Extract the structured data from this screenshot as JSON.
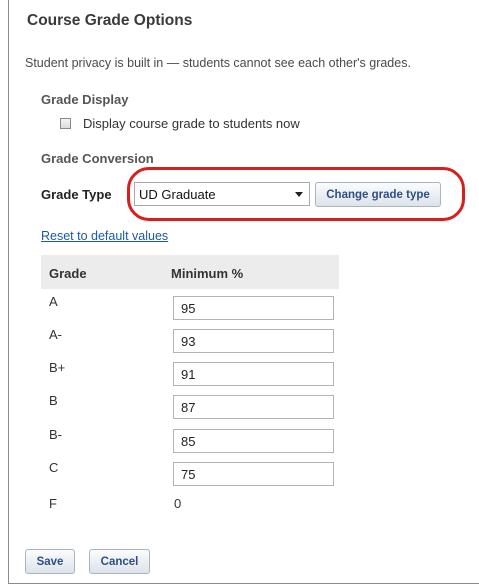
{
  "header": {
    "title": "Course Grade Options",
    "privacy_note": "Student privacy is built in — students cannot see each other's grades."
  },
  "grade_display": {
    "heading": "Grade Display",
    "checkbox_label": "Display course grade to students now",
    "checked": false
  },
  "grade_conversion": {
    "heading": "Grade Conversion",
    "grade_type_label": "Grade Type",
    "selected_type": "UD Graduate",
    "change_button": "Change grade type",
    "reset_link": "Reset to default values"
  },
  "grade_table": {
    "col_grade": "Grade",
    "col_minimum": "Minimum %",
    "rows": [
      {
        "grade": "A",
        "minimum": "95"
      },
      {
        "grade": "A-",
        "minimum": "93"
      },
      {
        "grade": "B+",
        "minimum": "91"
      },
      {
        "grade": "B",
        "minimum": "87"
      },
      {
        "grade": "B-",
        "minimum": "85"
      },
      {
        "grade": "C",
        "minimum": "75"
      },
      {
        "grade": "F",
        "minimum": "0"
      }
    ]
  },
  "actions": {
    "save": "Save",
    "cancel": "Cancel"
  },
  "colors": {
    "highlight": "#d81e1e",
    "link": "#1a5aa6",
    "button_text": "#2d4f84"
  }
}
